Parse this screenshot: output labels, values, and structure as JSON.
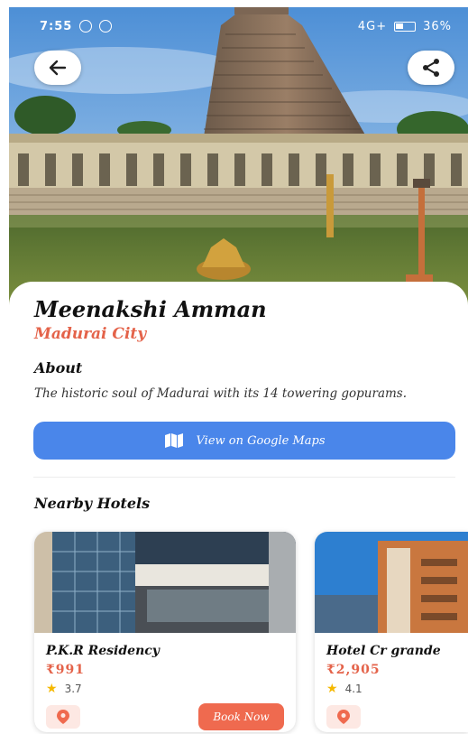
{
  "status_bar": {
    "time": "7:55",
    "network": "4G+",
    "battery": "36%"
  },
  "place": {
    "name": "Meenakshi Amman",
    "city": "Madurai City"
  },
  "about": {
    "heading": "About",
    "text": "The historic soul of Madurai with its 14 towering gopurams."
  },
  "maps_button": {
    "label": "View on Google Maps"
  },
  "nearby": {
    "heading": "Nearby Hotels",
    "hotels": [
      {
        "name": "P.K.R Residency",
        "price": "₹991",
        "rating": "3.7",
        "book_label": "Book Now"
      },
      {
        "name": "Hotel Cr grande",
        "price": "₹2,905",
        "rating": "4.1"
      }
    ]
  },
  "colors": {
    "accent": "#e4634a",
    "maps_blue": "#4a86ea",
    "book_button": "#ef6a4f",
    "star": "#f5b800"
  },
  "icons": [
    "arrow-left-icon",
    "share-icon",
    "map-icon",
    "star-icon",
    "location-pin-icon"
  ]
}
